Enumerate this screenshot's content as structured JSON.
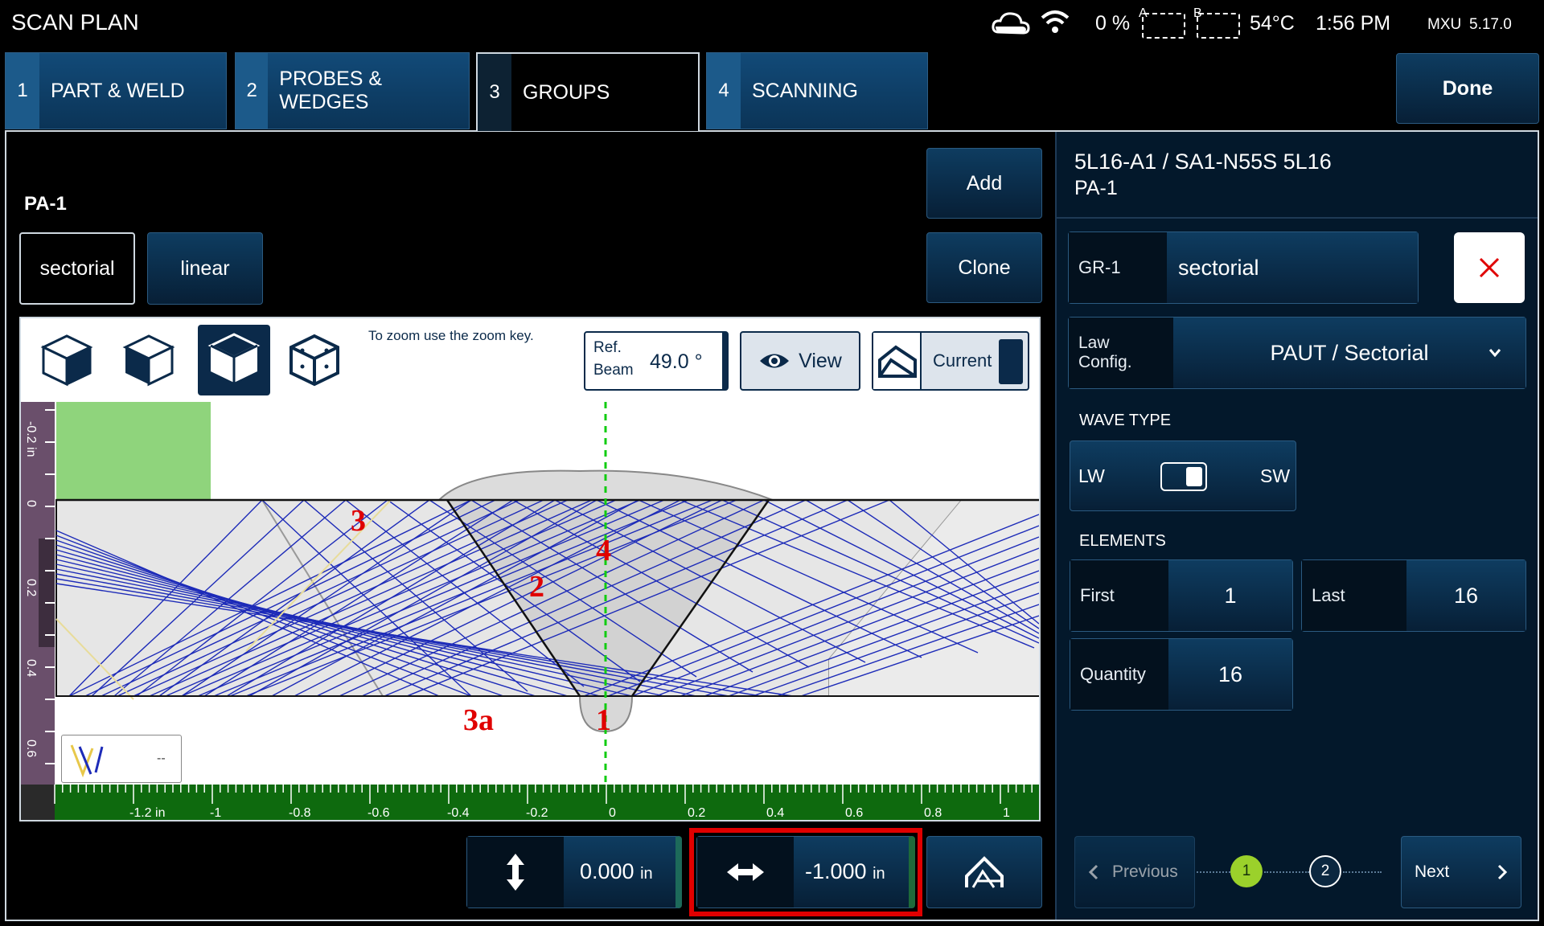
{
  "app": {
    "title": "SCAN PLAN"
  },
  "status_bar": {
    "battery_percent": "0 %",
    "slot_a": "A",
    "slot_b": "B",
    "temperature": "54°C",
    "time": "1:56 PM",
    "device": "MXU",
    "version": "5.17.0",
    "icons": [
      "cloud-icon",
      "wifi-icon",
      "sd-card-icon"
    ]
  },
  "tabs": [
    {
      "num": "1",
      "label": "PART & WELD"
    },
    {
      "num": "2",
      "label": "PROBES & WEDGES"
    },
    {
      "num": "3",
      "label": "GROUPS"
    },
    {
      "num": "4",
      "label": "SCANNING"
    }
  ],
  "active_tab": "3",
  "done_label": "Done",
  "left": {
    "group_name": "PA-1",
    "type_buttons": [
      "sectorial",
      "linear"
    ],
    "selected_type": "sectorial",
    "add_label": "Add",
    "clone_label": "Clone",
    "zoom_hint": "To zoom use the zoom key.",
    "ref_beam_label_1": "Ref.",
    "ref_beam_label_2": "Beam",
    "ref_beam_value": "49.0 °",
    "view_label": "View",
    "current_label": "Current",
    "legend_value": "--",
    "markers": [
      "3",
      "4",
      "2",
      "3a",
      "1"
    ],
    "x_axis_ticks": [
      "-1.2 in",
      "-1",
      "-0.8",
      "-0.6",
      "-0.4",
      "-0.2",
      "0",
      "0.2",
      "0.4",
      "0.6",
      "0.8",
      "1"
    ],
    "y_axis_ticks": [
      "-0.2 in",
      "0",
      "0.2",
      "0.4",
      "0.6"
    ],
    "vertical_offset": "0.000",
    "horizontal_offset": "-1.000",
    "unit": "in"
  },
  "right": {
    "probe_title": "5L16-A1 / SA1-N55S 5L16",
    "group_subtitle": "PA-1",
    "gr_label": "GR-1",
    "gr_value": "sectorial",
    "law_config_label_1": "Law",
    "law_config_label_2": "Config.",
    "law_config_value": "PAUT / Sectorial",
    "wave_type_heading": "WAVE TYPE",
    "wave_lw": "LW",
    "wave_sw": "SW",
    "elements_heading": "ELEMENTS",
    "first_label": "First",
    "first_value": "1",
    "last_label": "Last",
    "last_value": "16",
    "quantity_label": "Quantity",
    "quantity_value": "16",
    "previous_label": "Previous",
    "next_label": "Next",
    "steps": [
      "1",
      "2"
    ],
    "current_step": "1"
  },
  "colors": {
    "accent_green": "#8bc34a",
    "highlight_red": "#e00000",
    "beam_blue": "#1d2bb8",
    "panel_bg": "#03182b"
  }
}
